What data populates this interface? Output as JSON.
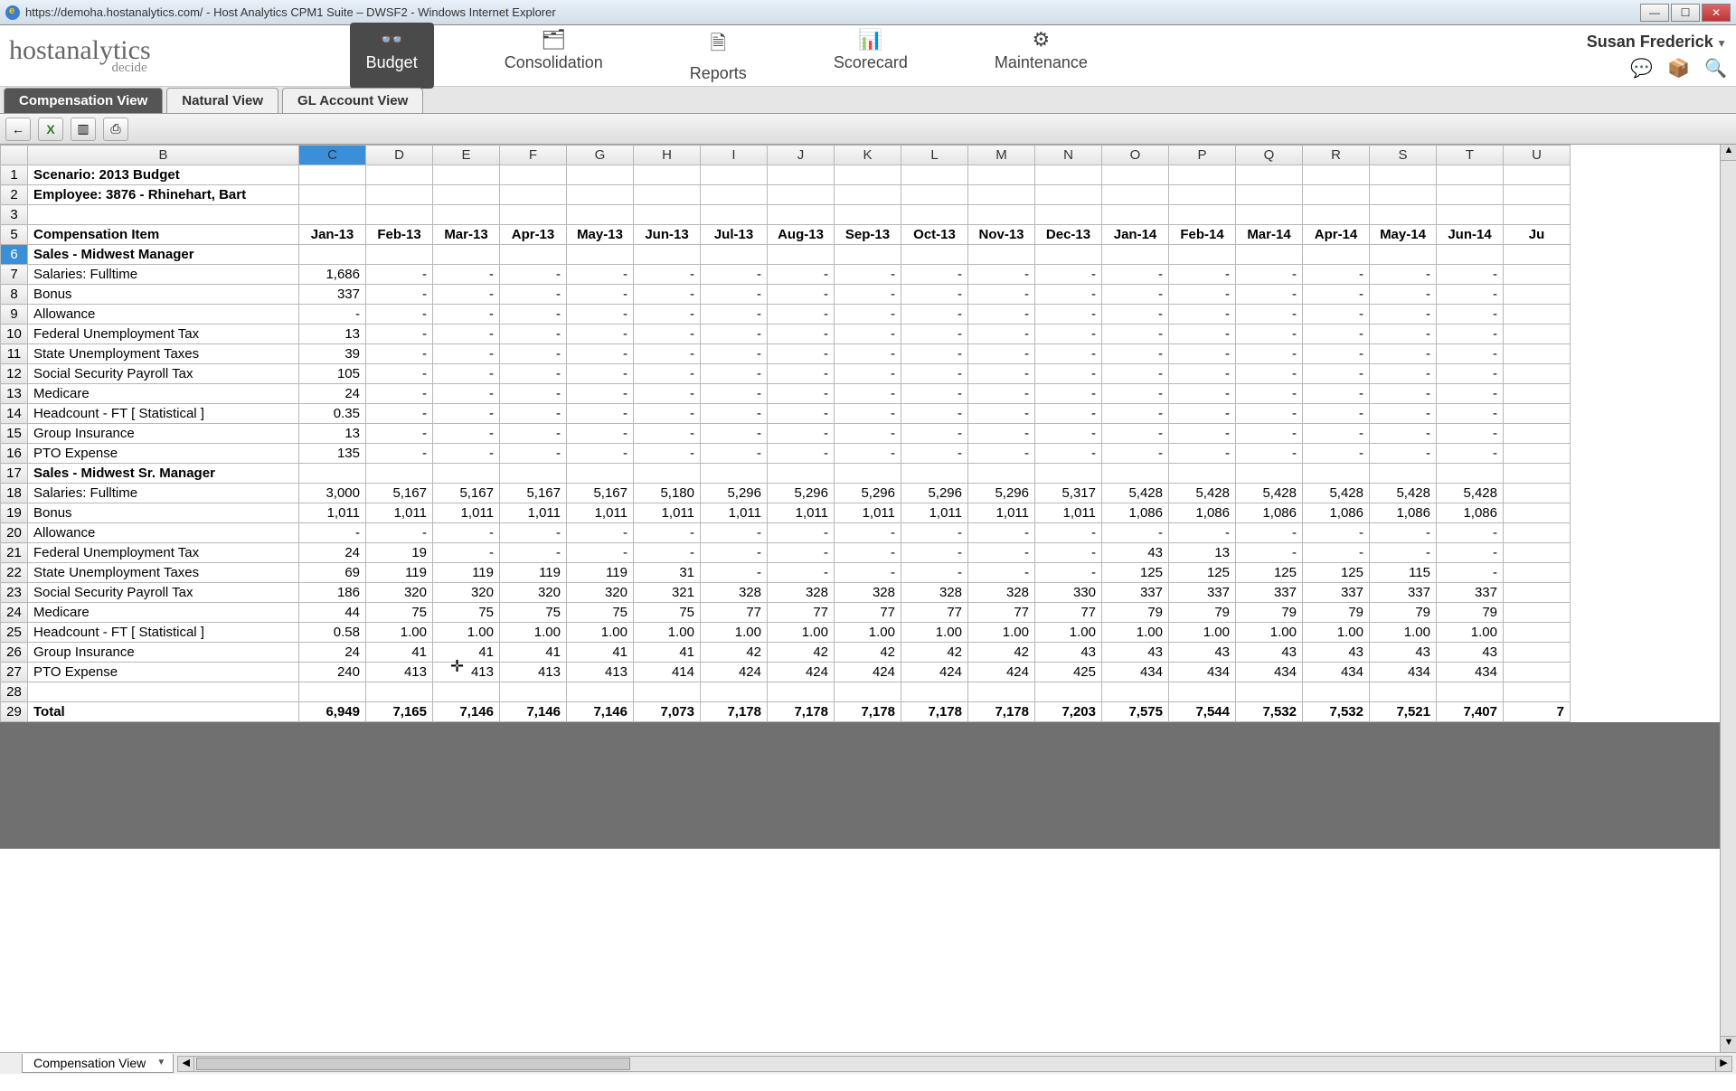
{
  "window": {
    "url": "https://demoha.hostanalytics.com/",
    "title": "Host Analytics CPM1 Suite – DWSF2 - Windows Internet Explorer"
  },
  "logo": {
    "main": "hostanalytics",
    "sub": "decide"
  },
  "nav": [
    {
      "label": "Budget",
      "icon": "👓",
      "active": true
    },
    {
      "label": "Consolidation",
      "icon": "🗂"
    },
    {
      "label": "Reports",
      "icon": "🗎"
    },
    {
      "label": "Scorecard",
      "icon": "📊"
    },
    {
      "label": "Maintenance",
      "icon": "⚙"
    }
  ],
  "user": {
    "name": "Susan Frederick"
  },
  "tabs": [
    {
      "label": "Compensation View",
      "active": true
    },
    {
      "label": "Natural View"
    },
    {
      "label": "GL Account View"
    }
  ],
  "toolbar": {
    "back": "←",
    "excel": "X",
    "export": "▥",
    "print": "⎙"
  },
  "sheet": {
    "columns": [
      "",
      "B",
      "C",
      "D",
      "E",
      "F",
      "G",
      "H",
      "I",
      "J",
      "K",
      "L",
      "M",
      "N",
      "O",
      "P",
      "Q",
      "R",
      "S",
      "T",
      "U"
    ],
    "selected_col": "C",
    "selected_row": 6,
    "row1": {
      "n": "1",
      "b": "Scenario: 2013 Budget"
    },
    "row2": {
      "n": "2",
      "b": "Employee: 3876 - Rhinehart, Bart"
    },
    "row3": {
      "n": "3",
      "b": ""
    },
    "row5_label": "Compensation Item",
    "months": [
      "Jan-13",
      "Feb-13",
      "Mar-13",
      "Apr-13",
      "May-13",
      "Jun-13",
      "Jul-13",
      "Aug-13",
      "Sep-13",
      "Oct-13",
      "Nov-13",
      "Dec-13",
      "Jan-14",
      "Feb-14",
      "Mar-14",
      "Apr-14",
      "May-14",
      "Jun-14",
      "Ju"
    ],
    "section1": "Sales - Midwest Manager",
    "section2": "Sales - Midwest Sr. Manager",
    "rows": {
      "7": {
        "label": "Salaries: Fulltime",
        "vals": [
          "1,686",
          "-",
          "-",
          "-",
          "-",
          "-",
          "-",
          "-",
          "-",
          "-",
          "-",
          "-",
          "-",
          "-",
          "-",
          "-",
          "-",
          "-",
          ""
        ]
      },
      "8": {
        "label": "Bonus",
        "vals": [
          "337",
          "-",
          "-",
          "-",
          "-",
          "-",
          "-",
          "-",
          "-",
          "-",
          "-",
          "-",
          "-",
          "-",
          "-",
          "-",
          "-",
          "-",
          ""
        ]
      },
      "9": {
        "label": "Allowance",
        "vals": [
          "-",
          "-",
          "-",
          "-",
          "-",
          "-",
          "-",
          "-",
          "-",
          "-",
          "-",
          "-",
          "-",
          "-",
          "-",
          "-",
          "-",
          "-",
          ""
        ]
      },
      "10": {
        "label": "Federal Unemployment Tax",
        "vals": [
          "13",
          "-",
          "-",
          "-",
          "-",
          "-",
          "-",
          "-",
          "-",
          "-",
          "-",
          "-",
          "-",
          "-",
          "-",
          "-",
          "-",
          "-",
          ""
        ]
      },
      "11": {
        "label": "State Unemployment Taxes",
        "vals": [
          "39",
          "-",
          "-",
          "-",
          "-",
          "-",
          "-",
          "-",
          "-",
          "-",
          "-",
          "-",
          "-",
          "-",
          "-",
          "-",
          "-",
          "-",
          ""
        ]
      },
      "12": {
        "label": "Social Security Payroll Tax",
        "vals": [
          "105",
          "-",
          "-",
          "-",
          "-",
          "-",
          "-",
          "-",
          "-",
          "-",
          "-",
          "-",
          "-",
          "-",
          "-",
          "-",
          "-",
          "-",
          ""
        ]
      },
      "13": {
        "label": "Medicare",
        "vals": [
          "24",
          "-",
          "-",
          "-",
          "-",
          "-",
          "-",
          "-",
          "-",
          "-",
          "-",
          "-",
          "-",
          "-",
          "-",
          "-",
          "-",
          "-",
          ""
        ]
      },
      "14": {
        "label": "Headcount - FT  [ Statistical ]",
        "vals": [
          "0.35",
          "-",
          "-",
          "-",
          "-",
          "-",
          "-",
          "-",
          "-",
          "-",
          "-",
          "-",
          "-",
          "-",
          "-",
          "-",
          "-",
          "-",
          ""
        ]
      },
      "15": {
        "label": "Group Insurance",
        "vals": [
          "13",
          "-",
          "-",
          "-",
          "-",
          "-",
          "-",
          "-",
          "-",
          "-",
          "-",
          "-",
          "-",
          "-",
          "-",
          "-",
          "-",
          "-",
          ""
        ]
      },
      "16": {
        "label": "PTO Expense",
        "vals": [
          "135",
          "-",
          "-",
          "-",
          "-",
          "-",
          "-",
          "-",
          "-",
          "-",
          "-",
          "-",
          "-",
          "-",
          "-",
          "-",
          "-",
          "-",
          ""
        ]
      },
      "18": {
        "label": "Salaries: Fulltime",
        "vals": [
          "3,000",
          "5,167",
          "5,167",
          "5,167",
          "5,167",
          "5,180",
          "5,296",
          "5,296",
          "5,296",
          "5,296",
          "5,296",
          "5,317",
          "5,428",
          "5,428",
          "5,428",
          "5,428",
          "5,428",
          "5,428",
          ""
        ]
      },
      "19": {
        "label": "Bonus",
        "vals": [
          "1,011",
          "1,011",
          "1,011",
          "1,011",
          "1,011",
          "1,011",
          "1,011",
          "1,011",
          "1,011",
          "1,011",
          "1,011",
          "1,011",
          "1,086",
          "1,086",
          "1,086",
          "1,086",
          "1,086",
          "1,086",
          ""
        ]
      },
      "20": {
        "label": "Allowance",
        "vals": [
          "-",
          "-",
          "-",
          "-",
          "-",
          "-",
          "-",
          "-",
          "-",
          "-",
          "-",
          "-",
          "-",
          "-",
          "-",
          "-",
          "-",
          "-",
          ""
        ]
      },
      "21": {
        "label": "Federal Unemployment Tax",
        "vals": [
          "24",
          "19",
          "-",
          "-",
          "-",
          "-",
          "-",
          "-",
          "-",
          "-",
          "-",
          "-",
          "43",
          "13",
          "-",
          "-",
          "-",
          "-",
          ""
        ]
      },
      "22": {
        "label": "State Unemployment Taxes",
        "vals": [
          "69",
          "119",
          "119",
          "119",
          "119",
          "31",
          "-",
          "-",
          "-",
          "-",
          "-",
          "-",
          "125",
          "125",
          "125",
          "125",
          "115",
          "-",
          ""
        ]
      },
      "23": {
        "label": "Social Security Payroll Tax",
        "vals": [
          "186",
          "320",
          "320",
          "320",
          "320",
          "321",
          "328",
          "328",
          "328",
          "328",
          "328",
          "330",
          "337",
          "337",
          "337",
          "337",
          "337",
          "337",
          ""
        ]
      },
      "24": {
        "label": "Medicare",
        "vals": [
          "44",
          "75",
          "75",
          "75",
          "75",
          "75",
          "77",
          "77",
          "77",
          "77",
          "77",
          "77",
          "79",
          "79",
          "79",
          "79",
          "79",
          "79",
          ""
        ]
      },
      "25": {
        "label": "Headcount - FT  [ Statistical ]",
        "vals": [
          "0.58",
          "1.00",
          "1.00",
          "1.00",
          "1.00",
          "1.00",
          "1.00",
          "1.00",
          "1.00",
          "1.00",
          "1.00",
          "1.00",
          "1.00",
          "1.00",
          "1.00",
          "1.00",
          "1.00",
          "1.00",
          ""
        ]
      },
      "26": {
        "label": "Group Insurance",
        "vals": [
          "24",
          "41",
          "41",
          "41",
          "41",
          "41",
          "42",
          "42",
          "42",
          "42",
          "42",
          "43",
          "43",
          "43",
          "43",
          "43",
          "43",
          "43",
          ""
        ]
      },
      "27": {
        "label": "PTO Expense",
        "vals": [
          "240",
          "413",
          "413",
          "413",
          "413",
          "414",
          "424",
          "424",
          "424",
          "424",
          "424",
          "425",
          "434",
          "434",
          "434",
          "434",
          "434",
          "434",
          ""
        ]
      }
    },
    "total_label": "Total",
    "totals": [
      "6,949",
      "7,165",
      "7,146",
      "7,146",
      "7,146",
      "7,073",
      "7,178",
      "7,178",
      "7,178",
      "7,178",
      "7,178",
      "7,203",
      "7,575",
      "7,544",
      "7,532",
      "7,532",
      "7,521",
      "7,407",
      "7"
    ]
  },
  "bottom_tab": "Compensation View"
}
